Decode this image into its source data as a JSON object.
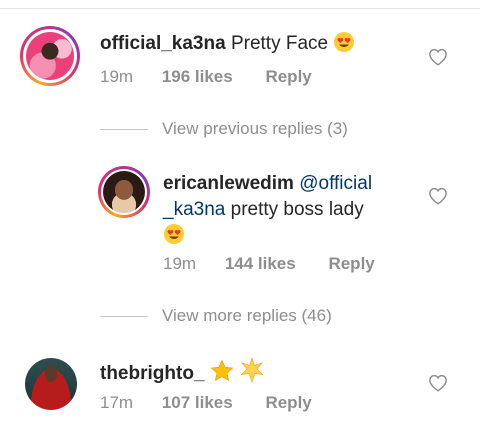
{
  "comments": [
    {
      "username": "official_ka3na",
      "text": "Pretty Face",
      "emoji": "heart-eyes-emoji",
      "time": "19m",
      "likes": "196 likes",
      "reply": "Reply"
    },
    {
      "username": "ericanlewedim",
      "mention_line1": "@official",
      "mention_line2": "_ka3na",
      "text": " pretty boss lady",
      "emoji": "heart-eyes-emoji",
      "time": "19m",
      "likes": "144 likes",
      "reply": "Reply"
    },
    {
      "username": "thebrighto_",
      "emoji": "star-emojis",
      "time": "17m",
      "likes": "107 likes",
      "reply": "Reply"
    }
  ],
  "threads": {
    "view_previous": "View previous replies (3)",
    "view_more": "View more replies (46)"
  },
  "colors": {
    "text": "#262626",
    "meta": "#8e8e8e",
    "mention": "#00376b",
    "divider": "#e6e6e6"
  }
}
